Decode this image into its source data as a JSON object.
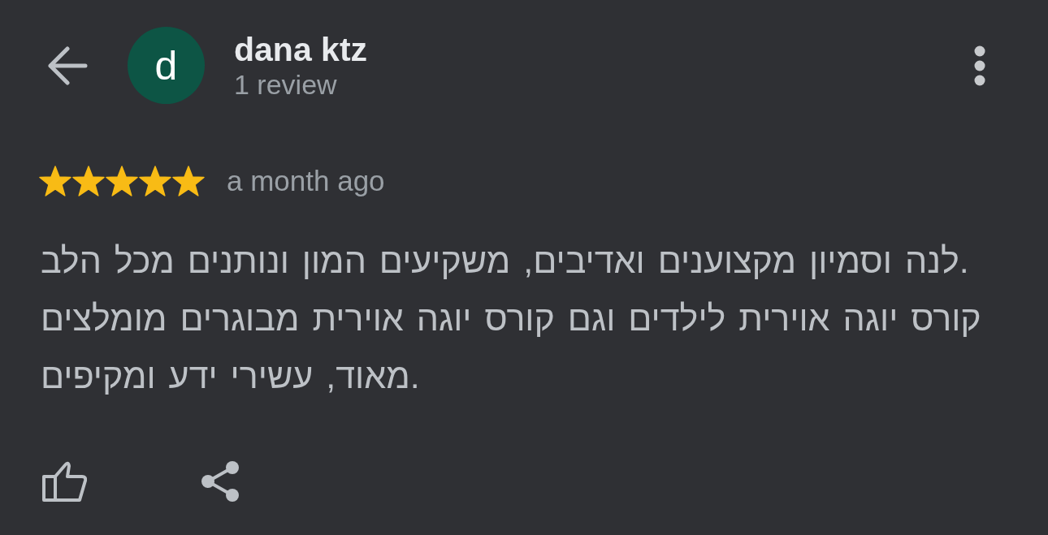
{
  "reviewer": {
    "initial": "d",
    "name": "dana ktz",
    "review_count": "1 review"
  },
  "review": {
    "stars": 5,
    "time": "a month ago",
    "text": "לנה וסמיון מקצוענים ואדיבים, משקיעים המון ונותנים מכל הלב.\nקורס יוגה אוירית לילדים וגם קורס יוגה אוירית מבוגרים מומלצים מאוד, עשירי ידע ומקיפים."
  }
}
